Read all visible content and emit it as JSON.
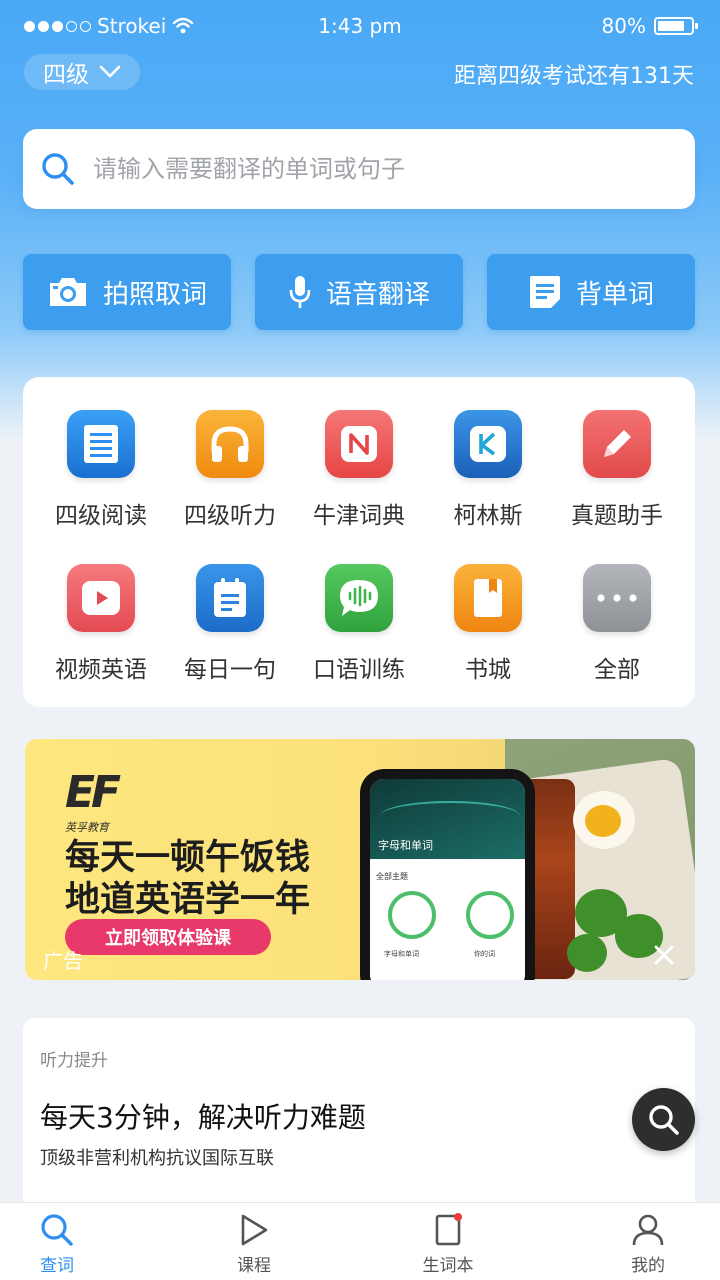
{
  "status_bar": {
    "carrier": "Strokei",
    "time": "1:43 pm",
    "battery_text": "80%",
    "battery_level": 0.8
  },
  "header": {
    "level": "四级",
    "countdown": "距离四级考试还有131天"
  },
  "search": {
    "placeholder": "请输入需要翻译的单词或句子"
  },
  "quick_actions": [
    {
      "label": "拍照取词",
      "icon": "camera-icon"
    },
    {
      "label": "语音翻译",
      "icon": "microphone-icon"
    },
    {
      "label": "背单词",
      "icon": "notes-icon"
    }
  ],
  "features": [
    {
      "label": "四级阅读",
      "icon": "reading-icon",
      "color": "#2e8ff0"
    },
    {
      "label": "四级听力",
      "icon": "headphones-icon",
      "color": "#f39c1b"
    },
    {
      "label": "牛津词典",
      "icon": "oxford-n-icon",
      "color": "#ee5a5a"
    },
    {
      "label": "柯林斯",
      "icon": "collins-k-icon",
      "color": "#2a7fd8"
    },
    {
      "label": "真题助手",
      "icon": "pencil-icon",
      "color": "#ec5757"
    },
    {
      "label": "视频英语",
      "icon": "video-play-icon",
      "color": "#ec5a5f"
    },
    {
      "label": "每日一句",
      "icon": "daily-note-icon",
      "color": "#2c84de"
    },
    {
      "label": "口语训练",
      "icon": "speech-bubble-icon",
      "color": "#3fb54d"
    },
    {
      "label": "书城",
      "icon": "bookstore-icon",
      "color": "#f39a1a"
    },
    {
      "label": "全部",
      "icon": "more-dots-icon",
      "color": "#a0a3a8"
    }
  ],
  "banner": {
    "brand": "EF",
    "brand_sub": "英孚教育",
    "headline_line1": "每天一顿午饭钱",
    "headline_line2": "地道英语学一年",
    "cta": "立即领取体验课",
    "ad_tag": "广告",
    "phone_title": "字母和单词",
    "phone_section": "全部主题",
    "phone_item1": "字母和单词",
    "phone_item2": "你的词"
  },
  "article": {
    "category": "听力提升",
    "title": "每天3分钟，解决听力难题",
    "description": "顶级非营利机构抗议国际互联"
  },
  "tabs": [
    {
      "label": "查词",
      "icon": "search-icon",
      "active": true
    },
    {
      "label": "课程",
      "icon": "play-icon",
      "active": false
    },
    {
      "label": "生词本",
      "icon": "wordbook-icon",
      "active": false
    },
    {
      "label": "我的",
      "icon": "profile-icon",
      "active": false
    }
  ],
  "colors": {
    "primary": "#3d9ef0",
    "accent_blue": "#2d8ff0",
    "cta_pink": "#e8396a"
  }
}
